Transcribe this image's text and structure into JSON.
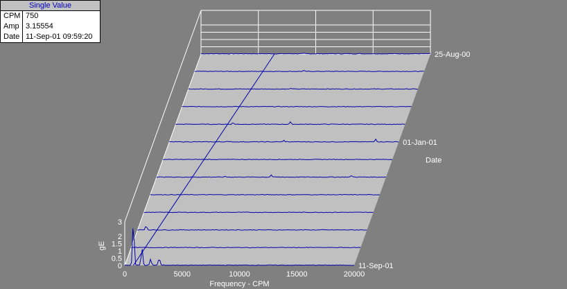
{
  "info_panel": {
    "title": "Single Value",
    "rows": [
      {
        "key": "CPM",
        "value": "750"
      },
      {
        "key": "Amp",
        "value": "3.15554"
      },
      {
        "key": "Date",
        "value": "11-Sep-01 09:59:20"
      }
    ]
  },
  "colors": {
    "background": "#808080",
    "floor": "#c0c0c0",
    "grid": "#ffffff",
    "trace": "#0000a8",
    "text": "#ffffff"
  },
  "chart_data": {
    "type": "waterfall",
    "title": "",
    "xlabel": "Frequency - CPM",
    "ylabel": "gE",
    "zlabel": "Date",
    "xlim": [
      0,
      20000
    ],
    "ylim": [
      0,
      3
    ],
    "x_ticks": [
      "0",
      "5000",
      "10000",
      "15000",
      "20000"
    ],
    "y_ticks": [
      "0",
      "0.5",
      "1",
      "1.5",
      "2",
      "3"
    ],
    "date_ticks": [
      "25-Aug-00",
      "01-Jan-01",
      "11-Sep-01"
    ],
    "grid": true,
    "traces": [
      {
        "date": "11-Sep-01",
        "peaks": [
          {
            "x": 750,
            "y": 3.16
          },
          {
            "x": 1500,
            "y": 1.2
          },
          {
            "x": 2250,
            "y": 0.4
          },
          {
            "x": 3000,
            "y": 0.5
          }
        ]
      },
      {
        "date": "",
        "peaks": []
      },
      {
        "date": "",
        "peaks": [
          {
            "x": 750,
            "y": 0.3
          }
        ]
      },
      {
        "date": "",
        "peaks": []
      },
      {
        "date": "",
        "peaks": []
      },
      {
        "date": "",
        "peaks": [
          {
            "x": 6000,
            "y": 0.05
          },
          {
            "x": 10000,
            "y": 0.15
          },
          {
            "x": 17000,
            "y": 0.1
          }
        ]
      },
      {
        "date": "",
        "peaks": []
      },
      {
        "date": "01-Jan-01",
        "peaks": [
          {
            "x": 5000,
            "y": 0.05
          },
          {
            "x": 10000,
            "y": 0.1
          },
          {
            "x": 18000,
            "y": 0.2
          }
        ]
      },
      {
        "date": "",
        "peaks": [
          {
            "x": 5000,
            "y": 0.1
          },
          {
            "x": 10000,
            "y": 0.15
          }
        ]
      },
      {
        "date": "",
        "peaks": []
      },
      {
        "date": "",
        "peaks": [
          {
            "x": 9000,
            "y": 0.05
          }
        ]
      },
      {
        "date": "",
        "peaks": [
          {
            "x": 9500,
            "y": 0.05
          }
        ]
      },
      {
        "date": "25-Aug-00",
        "peaks": [
          {
            "x": 9000,
            "y": 0.03
          }
        ]
      }
    ]
  }
}
